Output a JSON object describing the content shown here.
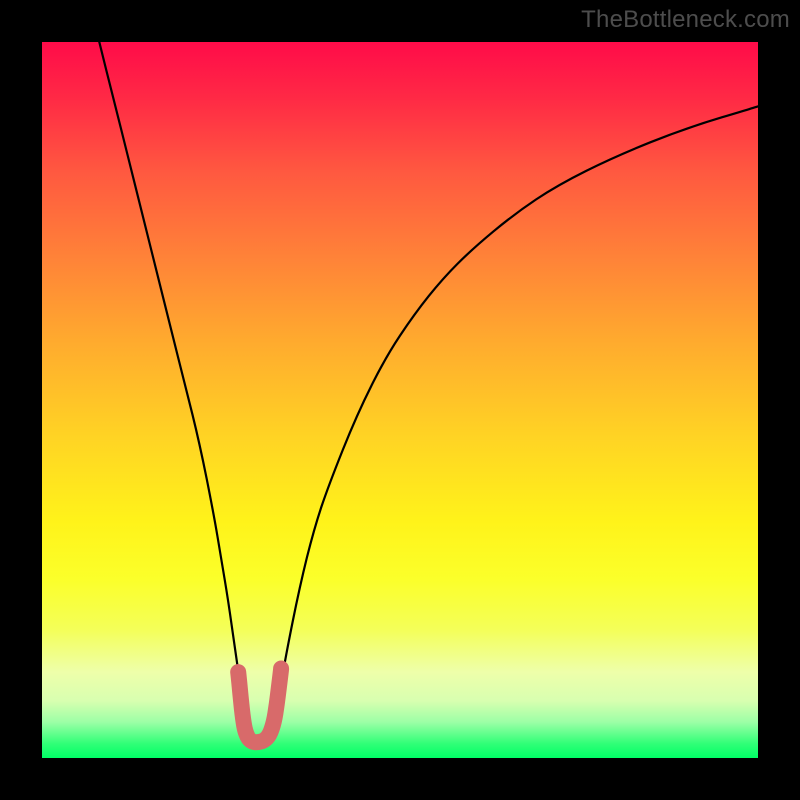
{
  "watermark": "TheBottleneck.com",
  "colors": {
    "frame": "#000000",
    "curve": "#000000",
    "highlight": "#d86a6a",
    "gradient_top": "#ff0b49",
    "gradient_bottom": "#00ff66"
  },
  "chart_data": {
    "type": "line",
    "title": "",
    "xlabel": "",
    "ylabel": "",
    "xlim": [
      0,
      100
    ],
    "ylim": [
      0,
      100
    ],
    "grid": false,
    "legend": false,
    "series": [
      {
        "name": "curve",
        "x": [
          8,
          10,
          12,
          14,
          16,
          18,
          20,
          22,
          24,
          25,
          26,
          27,
          28,
          29,
          30,
          31,
          32,
          33,
          34,
          36,
          38,
          40,
          44,
          48,
          52,
          56,
          60,
          66,
          72,
          80,
          90,
          100
        ],
        "y": [
          100,
          92,
          84,
          76,
          68,
          60,
          52,
          44,
          34,
          28,
          22,
          15,
          8,
          4,
          2,
          2,
          4,
          8,
          14,
          24,
          32,
          38,
          48,
          56,
          62,
          67,
          71,
          76,
          80,
          84,
          88,
          91
        ]
      },
      {
        "name": "highlight",
        "x": [
          27.4,
          27.7,
          28.0,
          28.3,
          28.8,
          29.5,
          30.2,
          31.0,
          31.8,
          32.4,
          32.8,
          33.1,
          33.4
        ],
        "y": [
          12,
          9,
          6,
          4,
          2.7,
          2.2,
          2.2,
          2.4,
          3.2,
          5,
          7.5,
          10,
          12.5
        ]
      }
    ]
  }
}
